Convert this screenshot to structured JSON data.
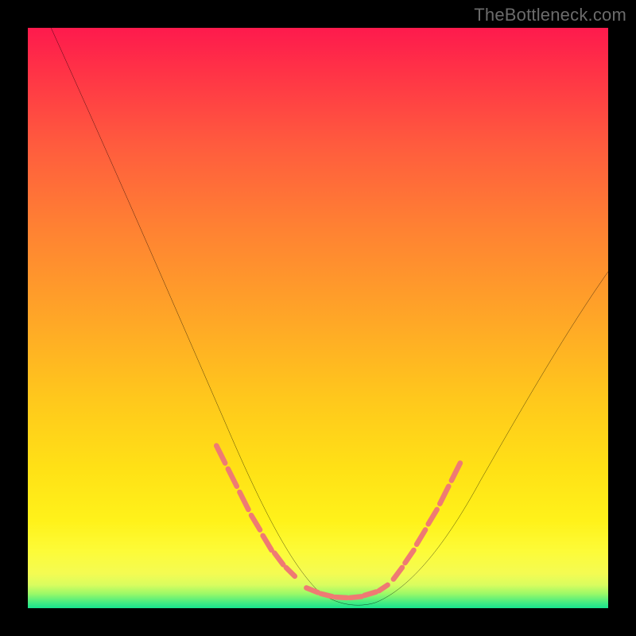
{
  "watermark": "TheBottleneck.com",
  "chart_data": {
    "type": "line",
    "title": "",
    "xlabel": "",
    "ylabel": "",
    "xlim": [
      0,
      100
    ],
    "ylim": [
      0,
      100
    ],
    "grid": false,
    "legend": false,
    "series": [
      {
        "name": "bottleneck-curve",
        "color": "#000000",
        "x": [
          4,
          8,
          12,
          16,
          20,
          24,
          28,
          32,
          36,
          40,
          44,
          47,
          50,
          53,
          56,
          59,
          62,
          66,
          70,
          74,
          78,
          82,
          86,
          90,
          94,
          98
        ],
        "y": [
          100,
          90,
          79,
          68,
          58,
          48,
          39,
          31,
          23,
          16,
          10,
          6,
          3,
          1,
          0,
          0,
          1,
          3,
          7,
          12,
          18,
          25,
          32,
          40,
          48,
          56
        ]
      }
    ],
    "valley_markers": {
      "comment": "salmon dashed segments near valley of curve",
      "color": "#ef7a73",
      "left_group_x_range": [
        33,
        45
      ],
      "right_group_x_range": [
        62,
        72
      ],
      "bottom_group_x_range": [
        48,
        61
      ]
    },
    "background_gradient": {
      "top": "#fe1a4d",
      "mid_upper": "#ff8a2e",
      "mid": "#ffd11c",
      "mid_lower": "#fff21a",
      "bottom": "#17e38e"
    }
  }
}
